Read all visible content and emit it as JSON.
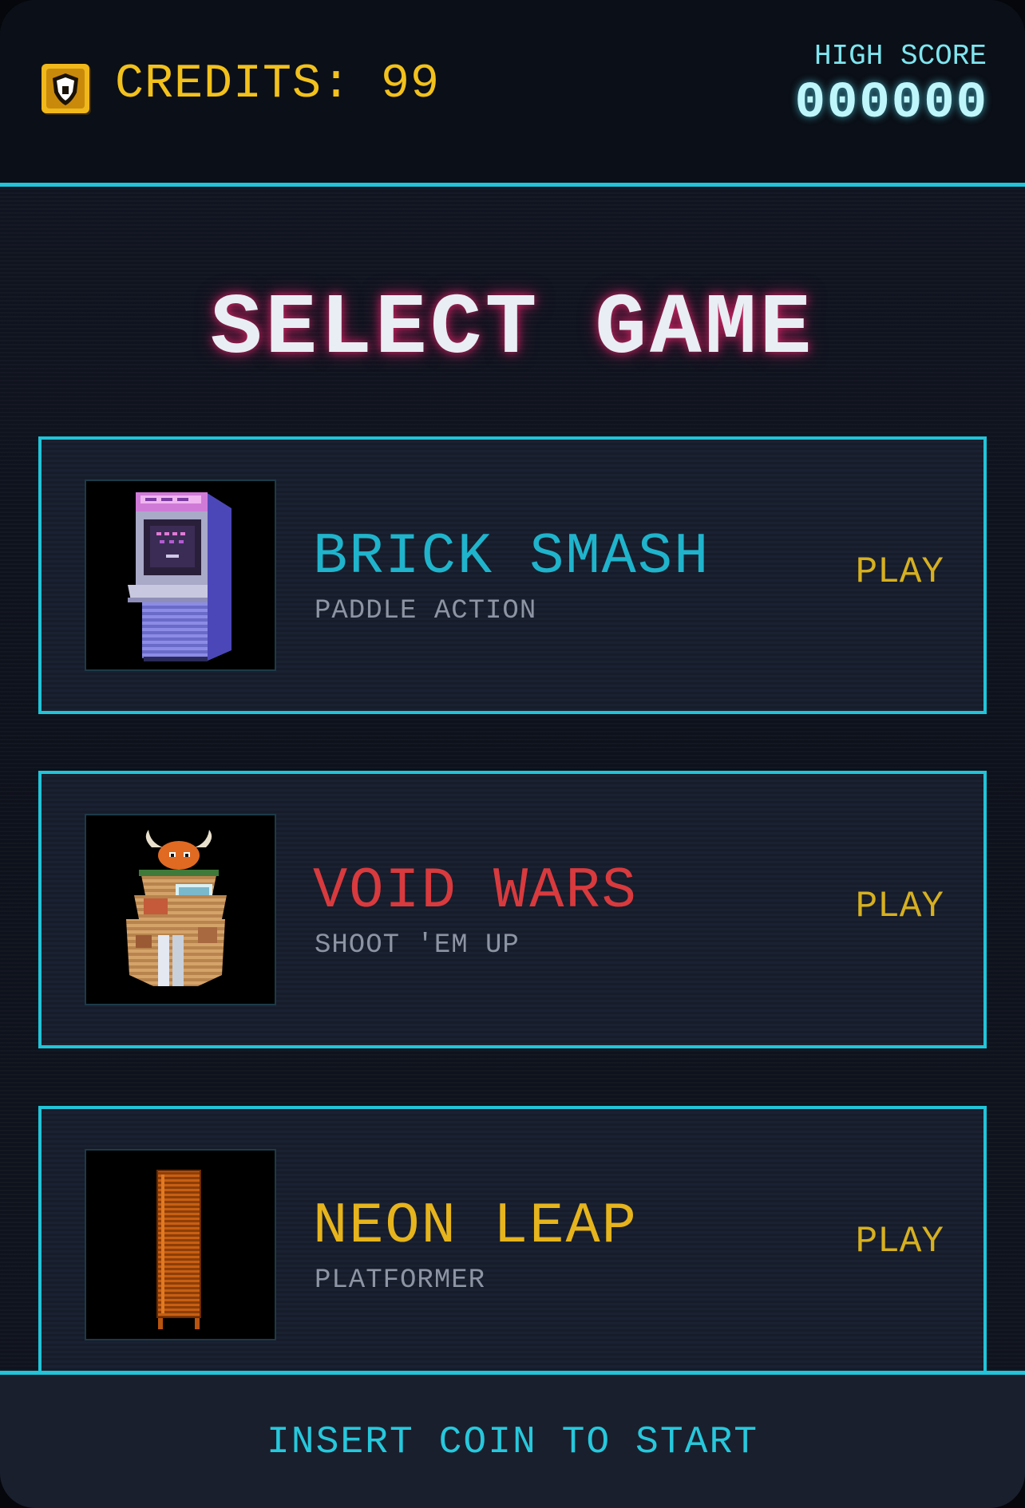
{
  "header": {
    "credits_text": "CREDITS: 99",
    "high_score_label": "HIGH SCORE",
    "high_score_value": "000000",
    "coin_icon": "shield-coin-icon"
  },
  "main": {
    "title": "SELECT GAME",
    "games": [
      {
        "name": "BRICK SMASH",
        "genre": "PADDLE ACTION",
        "play_label": "PLAY",
        "name_color": "#1fb4cc",
        "thumbnail": "arcade-cabinet-icon"
      },
      {
        "name": "VOID WARS",
        "genre": "SHOOT 'EM UP",
        "play_label": "PLAY",
        "name_color": "#d83a3e",
        "thumbnail": "horned-mech-icon"
      },
      {
        "name": "NEON LEAP",
        "genre": "PLATFORMER",
        "play_label": "PLAY",
        "name_color": "#e6b41c",
        "thumbnail": "orange-pillar-icon"
      }
    ]
  },
  "footer": {
    "insert_coin_text": "INSERT COIN TO START"
  },
  "colors": {
    "accent_cyan": "#21c4d8",
    "credits_gold": "#f2c11c",
    "play_gold": "#d6b020",
    "title_glow": "#eb286e"
  }
}
